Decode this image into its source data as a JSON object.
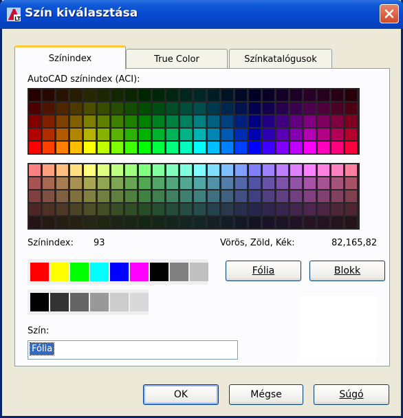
{
  "window": {
    "title": "Szín kiválasztása"
  },
  "tabs": [
    {
      "label": "Színindex",
      "active": true
    },
    {
      "label": "True Color",
      "active": false
    },
    {
      "label": "Színkatalógusok",
      "active": false
    }
  ],
  "aci": {
    "label": "AutoCAD színindex (ACI):",
    "hues_hex": [
      "#ff0000",
      "#ff3f00",
      "#ff7f00",
      "#ffbf00",
      "#ffff00",
      "#bfff00",
      "#7fff00",
      "#3fff00",
      "#00ff00",
      "#00ff3f",
      "#00ff7f",
      "#00ffbf",
      "#00ffff",
      "#00bfff",
      "#007fff",
      "#003fff",
      "#0000ff",
      "#3f00ff",
      "#7f00ff",
      "#bf00ff",
      "#ff00ff",
      "#ff00bf",
      "#ff007f",
      "#ff003f"
    ],
    "top_block_brightness": [
      0.15,
      0.3,
      0.5,
      0.7,
      1.0
    ],
    "bottom_block_pastel_mix": 0.5,
    "bottom_block_brightness": [
      1.0,
      0.65,
      0.5,
      0.3,
      0.15
    ]
  },
  "info": {
    "index_label": "Színindex:",
    "index_value": "93",
    "rgb_label": "Vörös, Zöld, Kék:",
    "rgb_value": "82,165,82"
  },
  "standard_colors": [
    "#ff0000",
    "#ffff00",
    "#00ff00",
    "#00ffff",
    "#0000ff",
    "#ff00ff",
    "#000000",
    "#808080",
    "#c0c0c0"
  ],
  "gray_shades": [
    "#000000",
    "#333333",
    "#646464",
    "#999999",
    "#cccccc",
    "#d9d9d9"
  ],
  "buttons": {
    "layer": "Fólia",
    "block": "Blokk",
    "ok": "OK",
    "cancel": "Mégse",
    "help": "Súgó"
  },
  "color_field": {
    "label": "Szín:",
    "value": "Fólia"
  }
}
